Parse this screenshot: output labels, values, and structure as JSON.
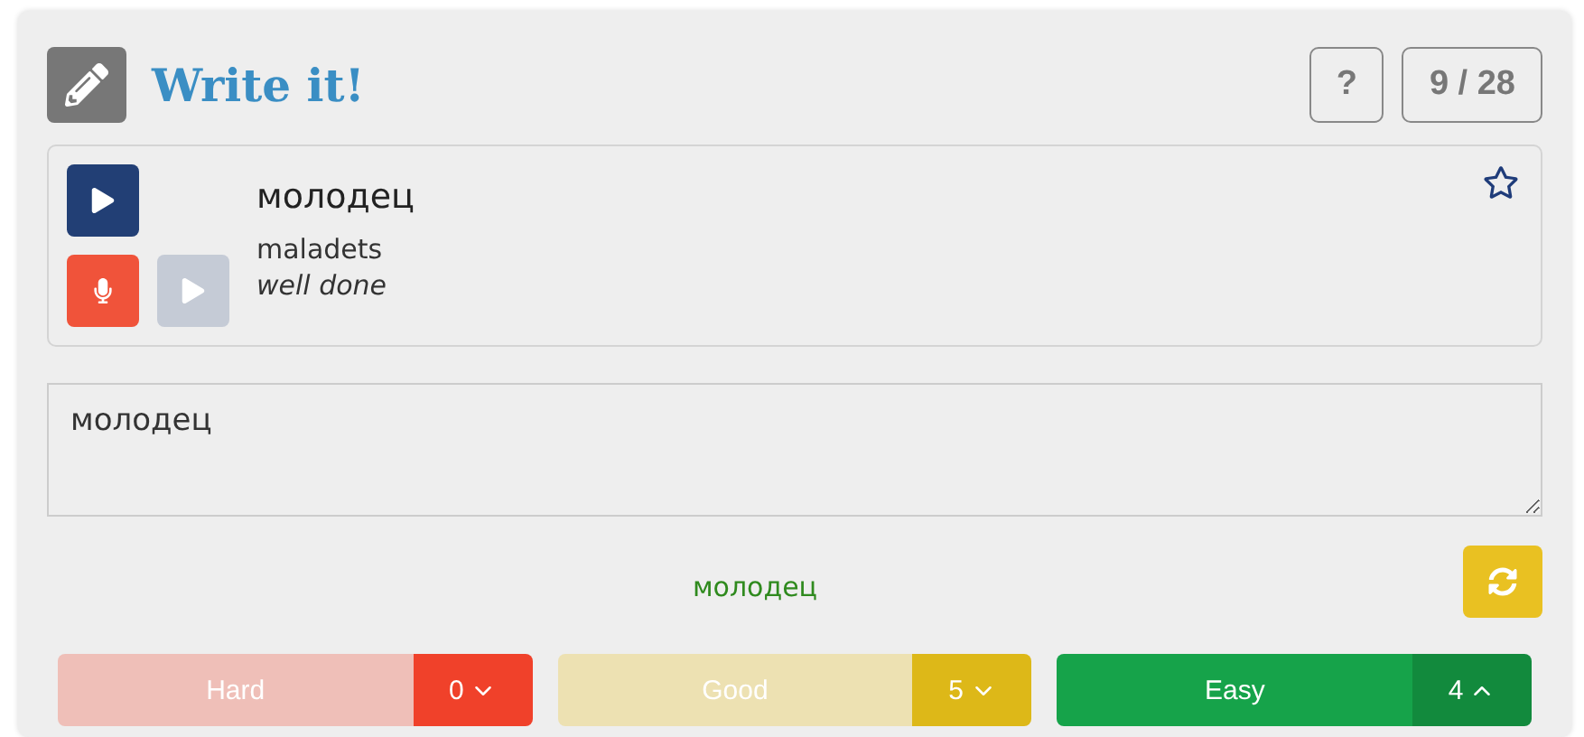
{
  "header": {
    "title": "Write it!",
    "help_label": "?",
    "progress": "9 / 28"
  },
  "word": {
    "text": "молодец",
    "transliteration": "maladets",
    "translation": "well done",
    "starred": false,
    "recording_play_disabled": true
  },
  "answer": {
    "value": "молодец"
  },
  "correct_answer": "молодец",
  "ratings": [
    {
      "label": "Hard",
      "count": "0",
      "kind": "hard",
      "selected": false,
      "expanded": false
    },
    {
      "label": "Good",
      "count": "5",
      "kind": "good",
      "selected": false,
      "expanded": false
    },
    {
      "label": "Easy",
      "count": "4",
      "kind": "easy",
      "selected": true,
      "expanded": true
    }
  ]
}
